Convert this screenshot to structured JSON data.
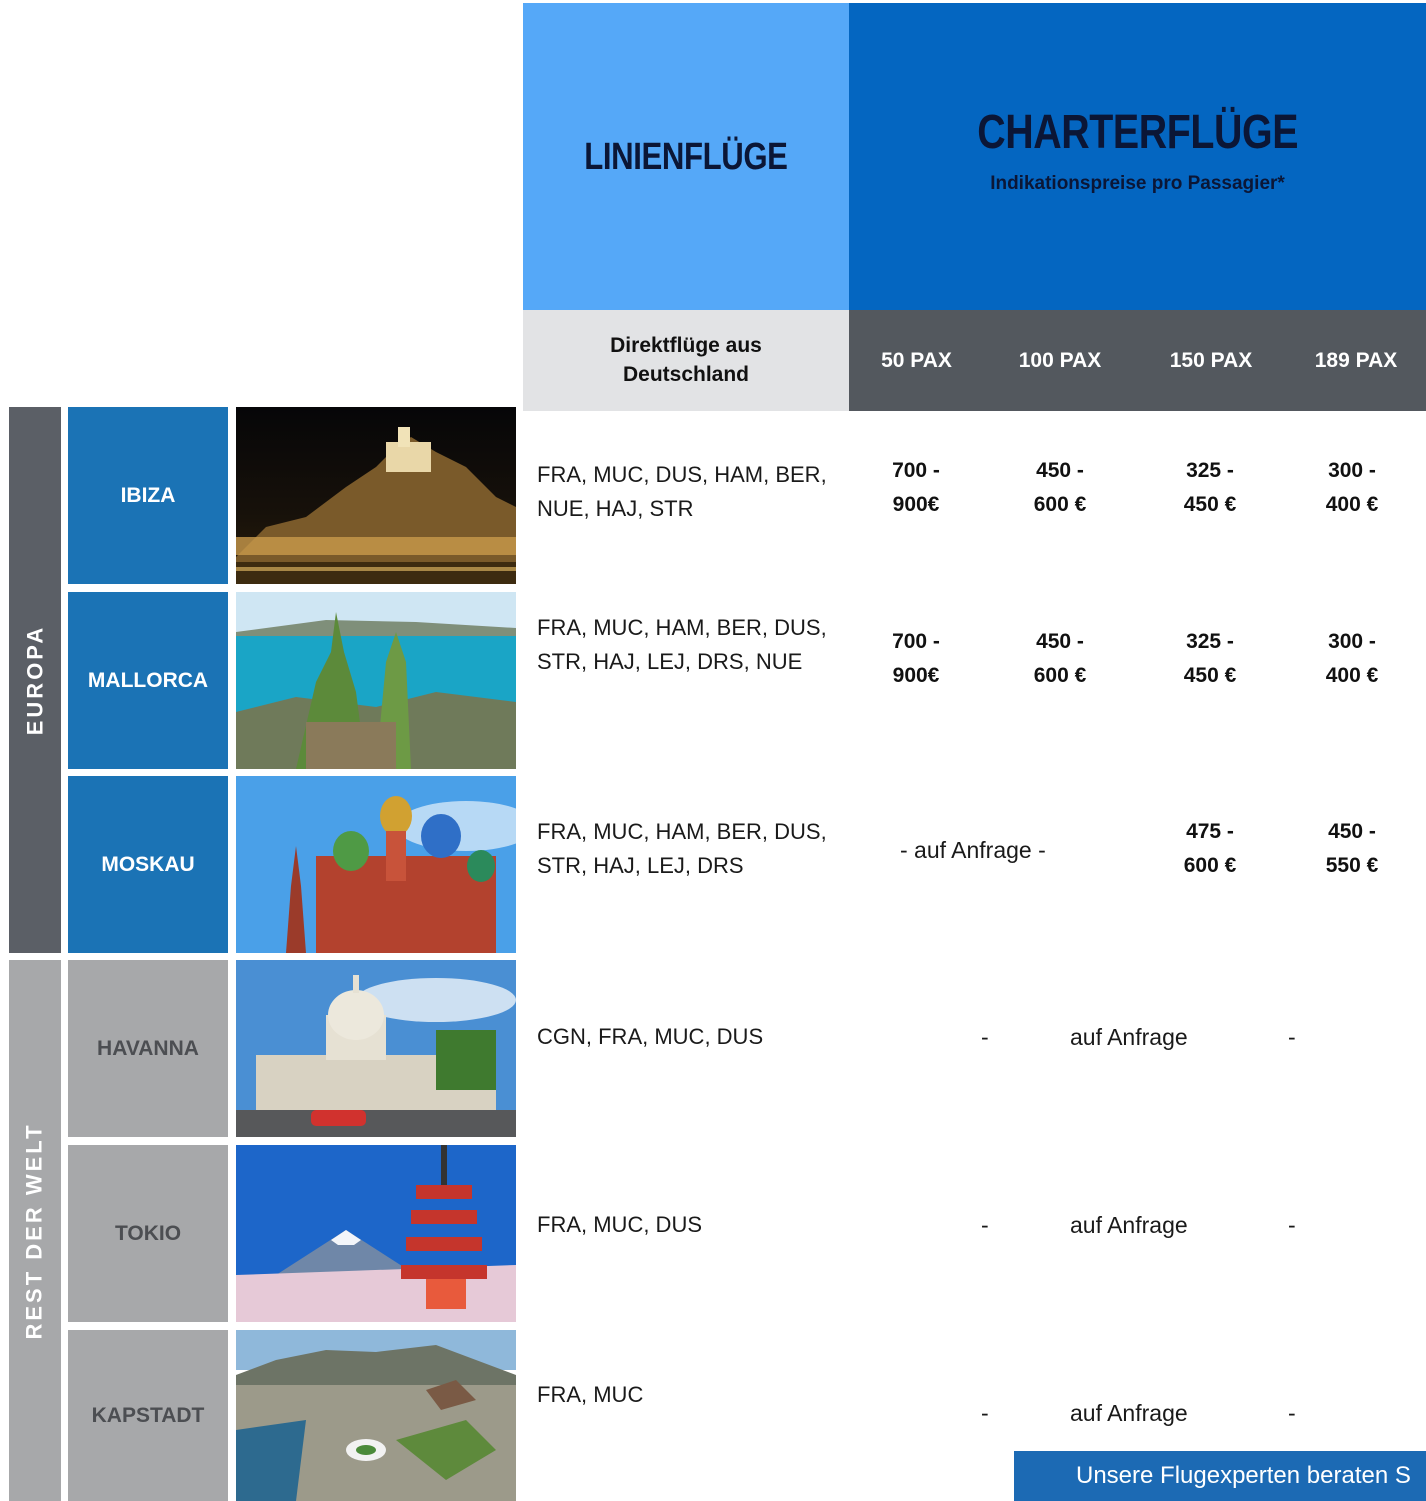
{
  "header": {
    "linienfluege": "LINIENFLÜGE",
    "charterfluege": "CHARTERFLÜGE",
    "charter_subtitle": "Indikationspreise pro Passagier*",
    "direkt_label": "Direktflüge aus Deutschland",
    "pax": [
      "50 PAX",
      "100 PAX",
      "150 PAX",
      "189 PAX"
    ]
  },
  "regions": {
    "europa": "EUROPA",
    "rest": "REST DER WELT"
  },
  "rows": [
    {
      "city": "IBIZA",
      "image": "ibiza-night-photo",
      "airports": "FRA, MUC, DUS, HAM, BER, NUE, HAJ, STR",
      "prices": [
        [
          "700 -",
          "900€"
        ],
        [
          "450 -",
          "600 €"
        ],
        [
          "325 -",
          "450 €"
        ],
        [
          "300 -",
          "400 €"
        ]
      ]
    },
    {
      "city": "MALLORCA",
      "image": "mallorca-coast-photo",
      "airports": "FRA, MUC, HAM, BER, DUS, STR, HAJ, LEJ, DRS, NUE",
      "prices": [
        [
          "700 -",
          "900€"
        ],
        [
          "450 -",
          "600 €"
        ],
        [
          "325 -",
          "450 €"
        ],
        [
          "300 -",
          "400 €"
        ]
      ]
    },
    {
      "city": "MOSKAU",
      "image": "moscow-basilica-photo",
      "airports": "FRA, MUC, HAM, BER, DUS, STR, HAJ, LEJ, DRS",
      "on_request": "-  auf Anfrage  -",
      "prices": [
        [
          "475 -",
          "600 €"
        ],
        [
          "450 -",
          "550 €"
        ]
      ]
    },
    {
      "city": "HAVANNA",
      "image": "havana-capitol-photo",
      "airports": "CGN, FRA, MUC, DUS",
      "dash": "-",
      "on_request": "auf Anfrage"
    },
    {
      "city": "TOKIO",
      "image": "tokyo-pagoda-photo",
      "airports": "FRA, MUC, DUS",
      "dash": "-",
      "on_request": "auf Anfrage"
    },
    {
      "city": "KAPSTADT",
      "image": "capetown-aerial-photo",
      "airports": "FRA, MUC",
      "dash": "-",
      "on_request": "auf Anfrage"
    }
  ],
  "banner": "Unsere Flugexperten beraten S",
  "colors": {
    "linien_blue": "#55a8f8",
    "charter_blue": "#0466c1",
    "city_blue": "#1b73b5",
    "region_gray": "#5b5f66",
    "rest_gray": "#a7a8aa"
  }
}
